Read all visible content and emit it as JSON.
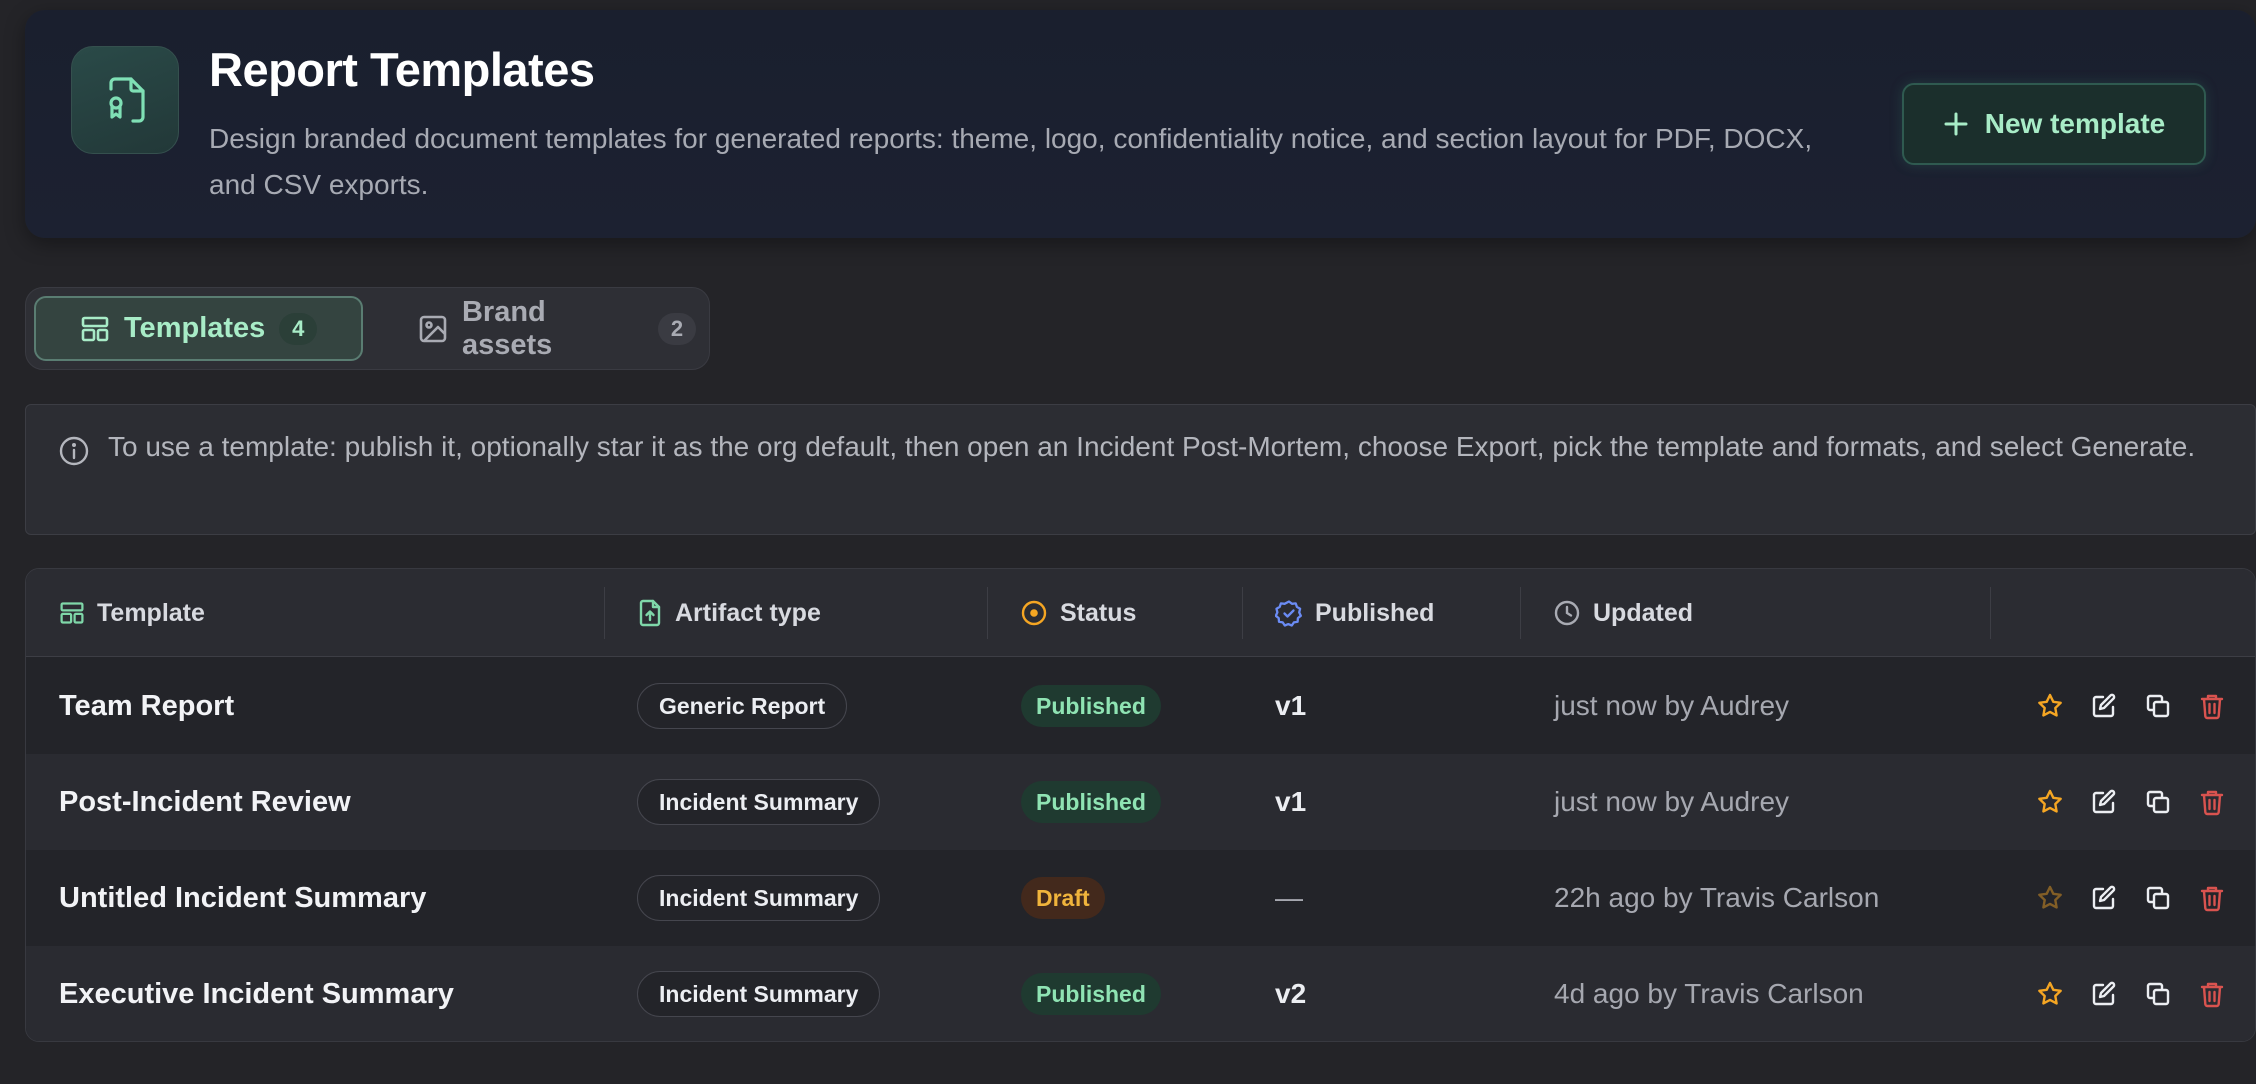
{
  "header": {
    "title": "Report Templates",
    "description": "Design branded document templates for generated reports: theme, logo, confidentiality notice, and section layout for PDF, DOCX, and CSV exports.",
    "new_button_label": "New template"
  },
  "tabs": [
    {
      "label": "Templates",
      "count": "4",
      "active": true
    },
    {
      "label": "Brand assets",
      "count": "2",
      "active": false
    }
  ],
  "info": {
    "text": "To use a template: publish it, optionally star it as the org default, then open an Incident Post-Mortem, choose Export, pick the template and formats, and select Generate."
  },
  "table": {
    "columns": [
      "Template",
      "Artifact type",
      "Status",
      "Published",
      "Updated"
    ],
    "rows": [
      {
        "name": "Team Report",
        "artifact": "Generic Report",
        "status": "Published",
        "published": "v1",
        "updated": "just now by Audrey"
      },
      {
        "name": "Post-Incident Review",
        "artifact": "Incident Summary",
        "status": "Published",
        "published": "v1",
        "updated": "just now by Audrey"
      },
      {
        "name": "Untitled Incident Summary",
        "artifact": "Incident Summary",
        "status": "Draft",
        "published": "—",
        "updated": "22h ago by Travis Carlson"
      },
      {
        "name": "Executive Incident Summary",
        "artifact": "Incident Summary",
        "status": "Published",
        "published": "v2",
        "updated": "4d ago by Travis Carlson"
      }
    ]
  },
  "colors": {
    "accent": "#a8ecc7",
    "star": "#f5a623",
    "delete": "#d9534f",
    "draft": "#f0b43c"
  }
}
